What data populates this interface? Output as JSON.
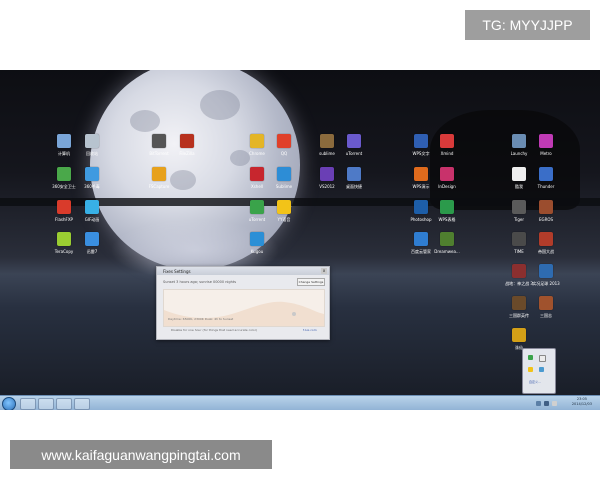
{
  "watermark_top": "TG: MYYJJPP",
  "watermark_bottom": "www.kaifaguanwangpingtai.com",
  "desktop_icons": [
    {
      "label": "计算机",
      "color": "#7aa6d8"
    },
    {
      "label": "回收站",
      "color": "#b7c3cf"
    },
    {
      "label": "360安全卫士",
      "color": "#4aa84a"
    },
    {
      "label": "360杀毒",
      "color": "#3f9ae0"
    },
    {
      "label": "FlashFXP",
      "color": "#d93b2b"
    },
    {
      "label": "GIF动画",
      "color": "#38b0e6"
    },
    {
      "label": "TeraCopy",
      "color": "#9acd32"
    },
    {
      "label": "迅雷7",
      "color": "#3a8fe0"
    },
    {
      "label": "BitTorrent",
      "color": "#555555"
    },
    {
      "label": "FileZilla",
      "color": "#b7311e"
    },
    {
      "label": "FSCapture",
      "color": "#e7a11c"
    },
    {
      "label": "Chrome",
      "color": "#e4b526"
    },
    {
      "label": "QQ",
      "color": "#e0402a"
    },
    {
      "label": "Xshell",
      "color": "#c7262e"
    },
    {
      "label": "Sublime",
      "color": "#2d8dd6"
    },
    {
      "label": "uTorrent",
      "color": "#3aa34a"
    },
    {
      "label": "YY语音",
      "color": "#f2c318"
    },
    {
      "label": "Kugou",
      "color": "#2b8fd6"
    },
    {
      "label": "sublime",
      "color": "#8b6b3d"
    },
    {
      "label": "uTorrent",
      "color": "#6a5acd"
    },
    {
      "label": "VS2012",
      "color": "#6a3fb5"
    },
    {
      "label": "桌面快捷",
      "color": "#4e7ac7"
    },
    {
      "label": "WPS文字",
      "color": "#2f5fb3"
    },
    {
      "label": "Xmind",
      "color": "#d83a3a"
    },
    {
      "label": "WPS演示",
      "color": "#e06b1d"
    },
    {
      "label": "InDesign",
      "color": "#c8326b"
    },
    {
      "label": "Photoshop",
      "color": "#1d5ea8"
    },
    {
      "label": "WPS表格",
      "color": "#2b9a4b"
    },
    {
      "label": "百度云管家",
      "color": "#2f7dd1"
    },
    {
      "label": "Dreamwea...",
      "color": "#4f7f2f"
    },
    {
      "label": "Launchy",
      "color": "#6a8db3"
    },
    {
      "label": "Metro",
      "color": "#c03ab5"
    },
    {
      "label": "酷我",
      "color": "#eeeeee"
    },
    {
      "label": "Thunder",
      "color": "#3a6ec8"
    },
    {
      "label": "Tiger",
      "color": "#5a5a5a"
    },
    {
      "label": "EGROS",
      "color": "#9b4d2e"
    },
    {
      "label": "TIME",
      "color": "#4a4a4a"
    },
    {
      "label": "帝国大战",
      "color": "#b13c2a"
    },
    {
      "label": "战地：神之战 3",
      "color": "#8b2f2f"
    },
    {
      "label": "实况足球 2013",
      "color": "#2e6bb0"
    },
    {
      "label": "三国群英传",
      "color": "#6a4a2a"
    },
    {
      "label": "三国志",
      "color": "#a0522d"
    },
    {
      "label": "诛仙",
      "color": "#d4a017"
    }
  ],
  "dialog": {
    "title": "Fixes Settings",
    "status": "Sunset 3 hours ago; sunrise 00000 nights",
    "button": "Change Settings",
    "footer": "Daytime: 6500K, 2300K Dusk: 4h to Sunset",
    "help_text": "Disable for one hour  (for things that need accurate color)",
    "link": "f.lux.com",
    "close": "x"
  },
  "tray_popup": {
    "customize": "自定义..."
  },
  "taskbar": {
    "clock_time": "23:05",
    "clock_date": "2014/12/03"
  }
}
